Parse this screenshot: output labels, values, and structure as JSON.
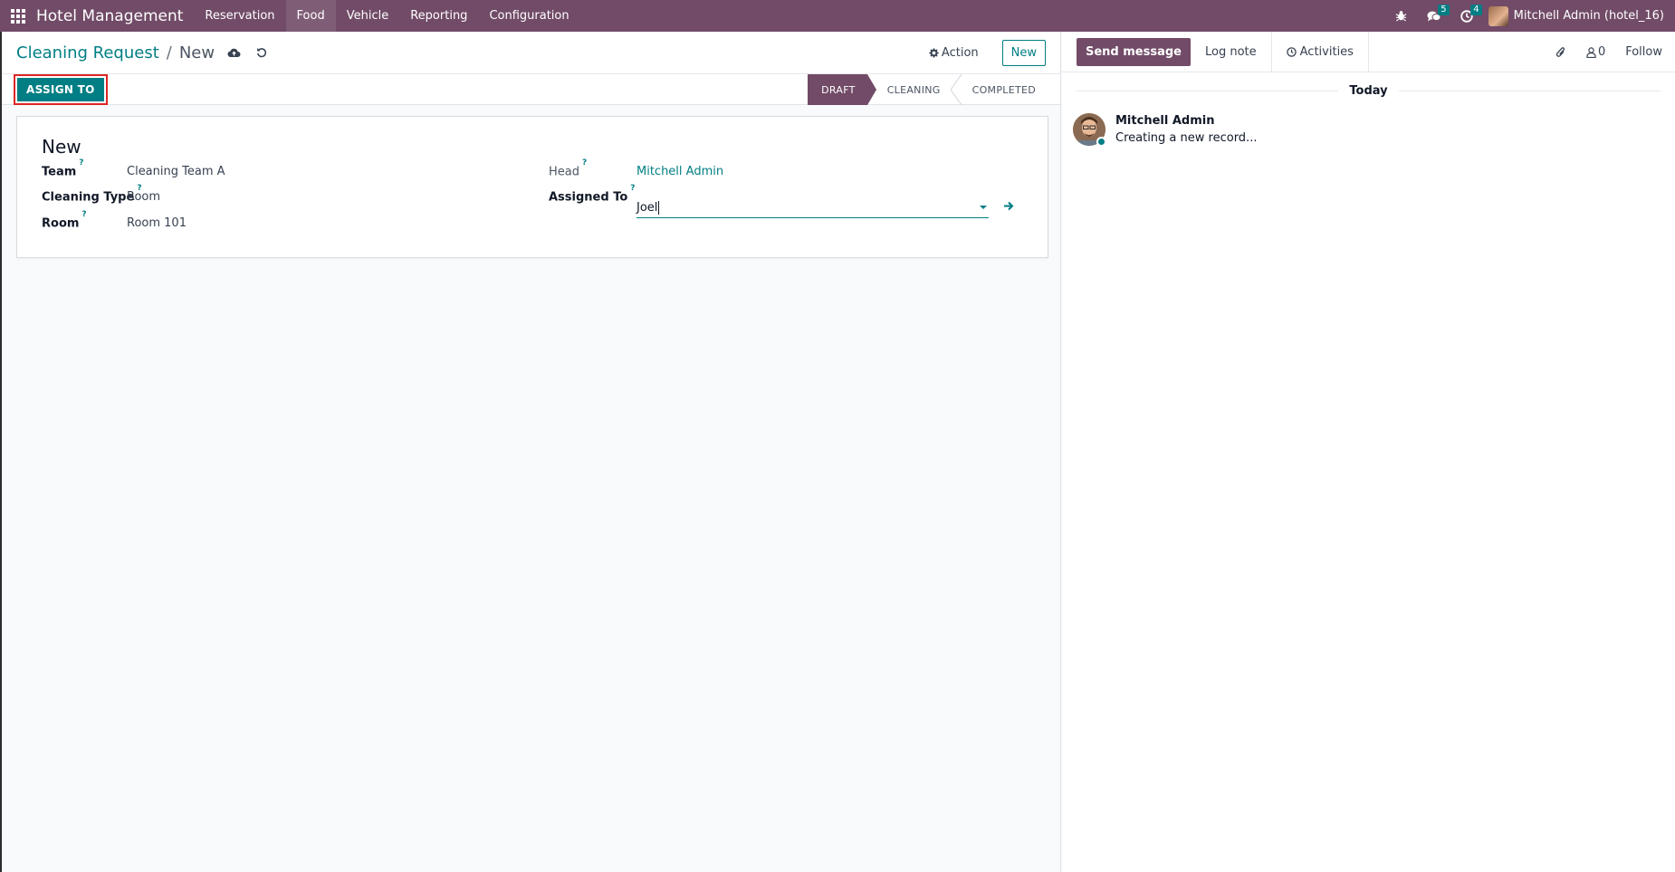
{
  "navbar": {
    "app_title": "Hotel Management",
    "menus": [
      "Reservation",
      "Food",
      "Vehicle",
      "Reporting",
      "Configuration"
    ],
    "active_menu": "Food",
    "messages_badge": "5",
    "activities_badge": "4",
    "user_name": "Mitchell Admin (hotel_16)"
  },
  "control_panel": {
    "breadcrumb_parent": "Cleaning Request",
    "breadcrumb_separator": "/",
    "breadcrumb_current": "New",
    "action_label": "Action",
    "new_label": "New",
    "assign_button_label": "ASSIGN TO",
    "stages": [
      "DRAFT",
      "CLEANING",
      "COMPLETED"
    ],
    "active_stage": "DRAFT"
  },
  "form": {
    "title": "New",
    "fields": {
      "team": {
        "label": "Team",
        "value": "Cleaning Team A"
      },
      "cleaning_type": {
        "label": "Cleaning Type",
        "value": "Room"
      },
      "room": {
        "label": "Room",
        "value": "Room 101"
      },
      "head": {
        "label": "Head",
        "value": "Mitchell Admin"
      },
      "assigned_to": {
        "label": "Assigned To",
        "value": "Joel"
      }
    },
    "help_mark": "?"
  },
  "chatter": {
    "send_message_label": "Send message",
    "log_note_label": "Log note",
    "activities_label": "Activities",
    "followers_count": "0",
    "follow_label": "Follow",
    "date_separator": "Today",
    "messages": [
      {
        "author": "Mitchell Admin",
        "body": "Creating a new record..."
      }
    ]
  },
  "colors": {
    "brand_purple": "#714b67",
    "accent_teal": "#017e84",
    "highlight_red": "#dc2626"
  }
}
